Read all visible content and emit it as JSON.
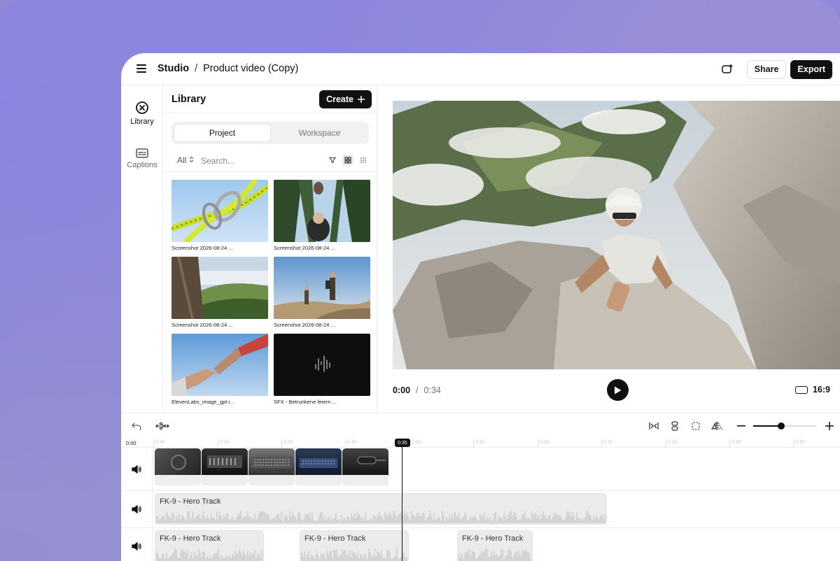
{
  "header": {
    "crumb_root": "Studio",
    "crumb_sep": "/",
    "crumb_current": "Product video (Copy)",
    "share_label": "Share",
    "export_label": "Export"
  },
  "rail": {
    "library_label": "Library",
    "captions_label": "Captions"
  },
  "library": {
    "title": "Library",
    "create_label": "Create",
    "tabs": [
      "Project",
      "Workspace"
    ],
    "active_tab": "Project",
    "filter_label": "All",
    "search_placeholder": "Search...",
    "items": [
      {
        "caption": "Screenshot 2026-08-24 ...",
        "kind": "image"
      },
      {
        "caption": "Screenshot 2026-08-24 ...",
        "kind": "image"
      },
      {
        "caption": "Screenshot 2026-08-24 ...",
        "kind": "image"
      },
      {
        "caption": "Screenshot 2026-08-24 ...",
        "kind": "image"
      },
      {
        "caption": "ElevenLabs_image_gpt-i...",
        "kind": "image"
      },
      {
        "caption": "SFX - Betrunkene feiern ...",
        "kind": "audio"
      }
    ]
  },
  "player": {
    "current_time": "0:00",
    "time_sep": "/",
    "duration": "0:34",
    "aspect_ratio": "16:9"
  },
  "timeline": {
    "start_label": "0:00",
    "tick_label": "0:45",
    "playhead_label": "0:35",
    "zoom_level": 0.44,
    "audio_tracks": [
      {
        "clips": [
          {
            "name": "FK-9 - Hero Track"
          }
        ]
      },
      {
        "clips": [
          {
            "name": "FK-9 - Hero Track"
          },
          {
            "name": "FK-9 - Hero Track"
          },
          {
            "name": "FK-9 - Hero Track"
          }
        ]
      }
    ]
  },
  "colors": {
    "accent": "#111111",
    "background": "#8f88d8"
  }
}
